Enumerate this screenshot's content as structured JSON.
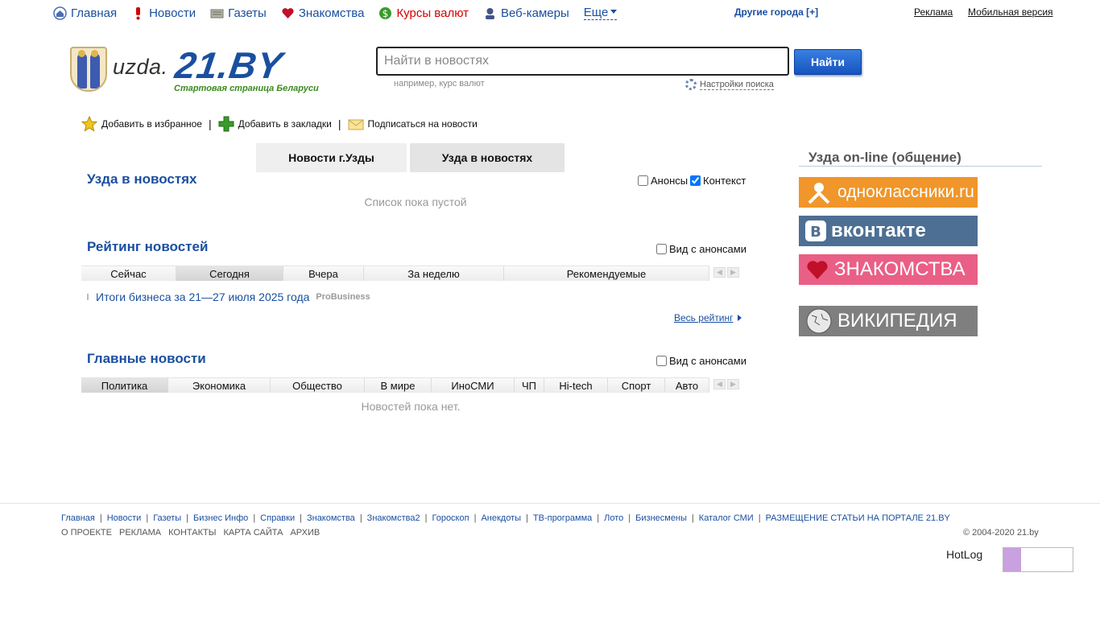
{
  "topnav": {
    "items": [
      {
        "label": "Главная",
        "icon": "home-icon"
      },
      {
        "label": "Новости",
        "icon": "exclamation-icon"
      },
      {
        "label": "Газеты",
        "icon": "newspaper-icon"
      },
      {
        "label": "Знакомства",
        "icon": "heart-icon"
      },
      {
        "label": "Курсы валют",
        "icon": "dollar-icon"
      },
      {
        "label": "Веб-камеры",
        "icon": "webcam-icon"
      }
    ],
    "more": "Еще",
    "other_cities": "Другие города [+]",
    "ads": "Реклама",
    "mobile": "Мобильная версия"
  },
  "header": {
    "city": "uzda.",
    "brand": "21.BY",
    "tagline": "Стартовая страница Беларуси"
  },
  "search": {
    "placeholder": "Найти в новостях",
    "button": "Найти",
    "hint": "например, курс валют",
    "settings": "Настройки поиска"
  },
  "bookmarks": {
    "favorites": "Добавить в избранное",
    "bookmarks": "Добавить в закладки",
    "subscribe": "Подписаться на новости"
  },
  "tabs": [
    "Новости г.Узды",
    "Узда в новостях"
  ],
  "section1": {
    "title": "Узда в новостях",
    "chk_announce": "Анонсы",
    "chk_context": "Контекст",
    "empty": "Список пока пустой"
  },
  "rating": {
    "title": "Рейтинг новостей",
    "chk": "Вид с анонсами",
    "filters": [
      "Сейчас",
      "Сегодня",
      "Вчера",
      "За неделю",
      "Рекомендуемые"
    ],
    "item": {
      "title": "Итоги бизнеса за 21—27 июля 2025 года",
      "source": "ProBusiness"
    },
    "all": "Весь рейтинг"
  },
  "main_news": {
    "title": "Главные новости",
    "chk": "Вид с анонсами",
    "filters": [
      "Политика",
      "Экономика",
      "Общество",
      "В мире",
      "ИноСМИ",
      "ЧП",
      "Hi-tech",
      "Спорт",
      "Авто"
    ],
    "empty": "Новостей пока нет."
  },
  "right": {
    "title": "Узда on-line (общение)",
    "banners": {
      "ok": "одноклассники.ru",
      "vk": "вконтакте",
      "zn": "ЗНАКОМСТВА",
      "wk": "ВИКИПЕДИЯ"
    }
  },
  "footer": {
    "links": [
      "Главная",
      "Новости",
      "Газеты",
      "Бизнес Инфо",
      "Справки",
      "Знакомства",
      "Знакомства2",
      "Гороскоп",
      "Анекдоты",
      "ТВ-программа",
      "Лото",
      "Бизнесмены",
      "Каталог СМИ",
      "РАЗМЕЩЕНИЕ СТАТЬИ НА ПОРТАЛЕ 21.BY"
    ],
    "links2": [
      "О ПРОЕКТЕ",
      "РЕКЛАМА",
      "КОНТАКТЫ",
      "КАРТА САЙТА",
      "АРХИВ"
    ],
    "copyright": "© 2004-2020 21.by",
    "hotlog": "HotLog"
  },
  "colors": {
    "link": "#1a4fa0",
    "accent_red": "#d40000",
    "ok": "#f0962a",
    "vk": "#4d6f94",
    "zn": "#ea5f86",
    "wk": "#7f7f7f"
  }
}
